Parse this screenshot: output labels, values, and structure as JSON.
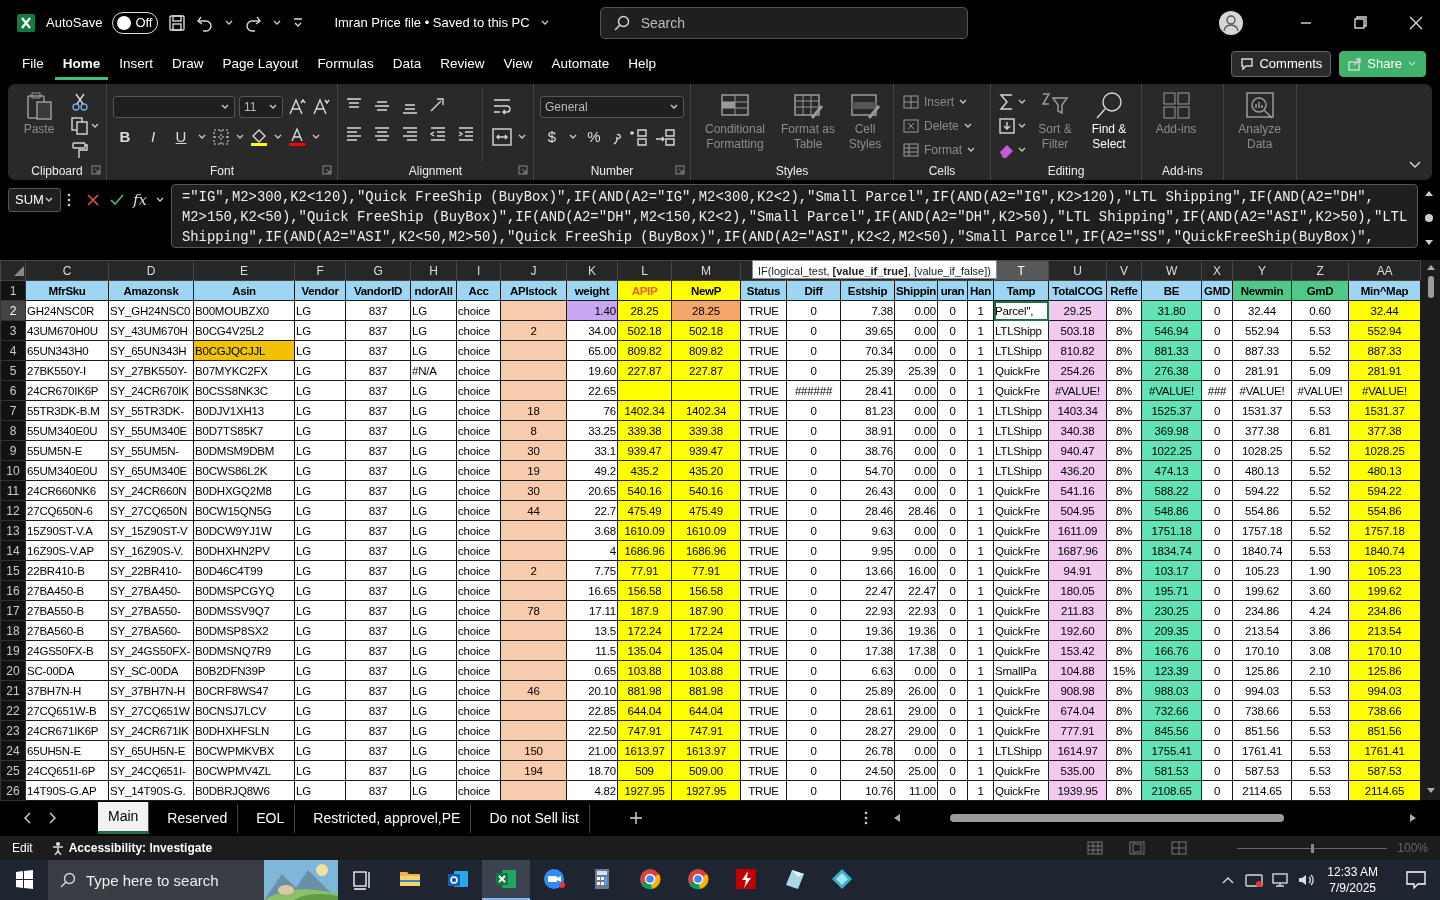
{
  "title_bar": {
    "autosave_label": "AutoSave",
    "autosave": {
      "on": false,
      "label": "Off"
    },
    "title": "Imran Price file • Saved to this PC",
    "search": {
      "placeholder": "Search"
    }
  },
  "menu": {
    "tabs": [
      {
        "label": "File",
        "selected": false
      },
      {
        "label": "Home",
        "selected": true
      },
      {
        "label": "Insert",
        "selected": false
      },
      {
        "label": "Draw",
        "selected": false
      },
      {
        "label": "Page Layout",
        "selected": false
      },
      {
        "label": "Formulas",
        "selected": false
      },
      {
        "label": "Data",
        "selected": false
      },
      {
        "label": "Review",
        "selected": false
      },
      {
        "label": "View",
        "selected": false
      },
      {
        "label": "Automate",
        "selected": false
      },
      {
        "label": "Help",
        "selected": false
      }
    ],
    "comments": "Comments",
    "share": "Share"
  },
  "ribbon": [
    {
      "kind": "clipboard",
      "label": "Clipboard",
      "items": [
        {
          "label": "Paste",
          "disabled": true
        }
      ]
    },
    {
      "kind": "font",
      "label": "Font",
      "font_size": "11",
      "buttons": [
        "B",
        "I",
        "U"
      ]
    },
    {
      "kind": "alignment",
      "label": "Alignment"
    },
    {
      "kind": "number",
      "label": "Number",
      "format": "General",
      "buttons": [
        "$",
        "%"
      ]
    },
    {
      "kind": "styles",
      "label": "Styles",
      "items": [
        {
          "label": "Conditional Formatting",
          "disabled": true
        },
        {
          "label": "Format as Table",
          "disabled": true
        },
        {
          "label": "Cell Styles",
          "disabled": true
        }
      ]
    },
    {
      "kind": "cells",
      "label": "Cells",
      "items": [
        {
          "label": "Insert",
          "disabled": true
        },
        {
          "label": "Delete",
          "disabled": true
        },
        {
          "label": "Format",
          "disabled": true
        }
      ]
    },
    {
      "kind": "editing",
      "label": "Editing",
      "items": [
        {
          "label": "Sort & Filter",
          "disabled": true
        },
        {
          "label": "Find & Select",
          "disabled": false
        }
      ]
    },
    {
      "kind": "addins",
      "label": "Add-ins",
      "items": [
        {
          "label": "Add-ins",
          "disabled": true
        }
      ]
    },
    {
      "kind": "analyze",
      "items": [
        {
          "label": "Analyze Data",
          "disabled": true
        }
      ]
    }
  ],
  "formula_bar": {
    "name_box": "SUM",
    "fx": "fx",
    "lines": [
      "=\"IG\",M2>300,K2<120),\"Quick FreeShip (BuyBox)\",IF(AND(A2=\"IG\",M2<300,K2<2),\"Small Parcel\",IF(AND(A2=\"IG\",K2>120),\"LTL Shipping\",IF(AND(A2=\"DH\",",
      "M2>150,K2<50),\"Quick FreeShip (BuyBox)\",IF(AND(A2=\"DH\",M2<150,K2<2),\"Small Parcel\",IF(AND(A2=\"DH\",K2>50),\"LTL Shipping\",IF(AND(A2=\"ASI\",K2>50),\"LTL",
      "Shipping\",IF(AND(A2=\"ASI\",K2<50,M2>50),\"Quick FreeShip (BuyBox)\",IF(AND(A2=\"ASI\",K2<2,M2<50),\"Small Parcel\",IF(A2=\"SS\",\"QuickFreeShip(BuyBox)\","
    ]
  },
  "tooltip": "IF(logical_test, **[value_if_true]**, [value_if_false])",
  "sheet": {
    "columns": [
      {
        "letter": "C",
        "selected": false
      },
      {
        "letter": "D",
        "selected": false
      },
      {
        "letter": "E",
        "selected": false
      },
      {
        "letter": "F",
        "selected": false
      },
      {
        "letter": "G",
        "selected": false
      },
      {
        "letter": "H",
        "selected": false
      },
      {
        "letter": "I",
        "selected": false
      },
      {
        "letter": "J",
        "color": "#f8cbad",
        "selected": false
      },
      {
        "letter": "K",
        "selected": false
      },
      {
        "letter": "L",
        "color": "#ffff00",
        "selected": false
      },
      {
        "letter": "M",
        "color": "#ffff00",
        "selected": false
      },
      {
        "selected": false
      },
      {
        "selected": false
      },
      {
        "selected": false
      },
      {
        "selected": false
      },
      {
        "selected": false
      },
      {
        "selected": false
      },
      {
        "letter": "T",
        "selected": true
      },
      {
        "letter": "U",
        "color": "#f2c9f0",
        "selected": false
      },
      {
        "letter": "V",
        "selected": false
      },
      {
        "letter": "W",
        "color": "#62e3b6",
        "selected": false
      },
      {
        "letter": "X",
        "selected": false
      },
      {
        "letter": "Y",
        "selected": false
      },
      {
        "letter": "Z",
        "selected": false
      },
      {
        "letter": "AA",
        "color": "#ffff00",
        "selected": false
      }
    ],
    "header": {
      "n": "1",
      "cells": [
        {
          "text": "MfrSku",
          "color": "#9dd5f2"
        },
        {
          "text": "Amazonsk",
          "color": "#9dd5f2"
        },
        {
          "text": "Asin",
          "color": "#9dd5f2"
        },
        {
          "text": "Vendor",
          "color": "#9dd5f2"
        },
        {
          "text": "VandorID",
          "color": "#9dd5f2"
        },
        {
          "text": "ndorAll",
          "color": "#9dd5f2"
        },
        {
          "text": "Acc",
          "color": "#9dd5f2"
        },
        {
          "text": "APIstock",
          "color": "#9dd5f2"
        },
        {
          "text": "weight",
          "color": "#9dd5f2"
        },
        {
          "text": "APIP",
          "color": "#ffff00",
          "kind": "alert"
        },
        {
          "text": "NewP",
          "color": "#ffff00"
        },
        {
          "text": "Status",
          "color": "#9dd5f2"
        },
        {
          "text": "Diff",
          "color": "#9dd5f2"
        },
        {
          "text": "Estship",
          "color": "#9dd5f2"
        },
        {
          "text": "Shippin",
          "color": "#9dd5f2"
        },
        {
          "text": "uran",
          "color": "#9dd5f2"
        },
        {
          "text": "Han",
          "color": "#9dd5f2"
        },
        {
          "text": "Tamp",
          "color": "#9dd5f2"
        },
        {
          "text": "TotalCOG",
          "color": "#9dd5f2"
        },
        {
          "text": "Reffe",
          "color": "#9dd5f2"
        },
        {
          "text": "BE",
          "color": "#9dd5f2"
        },
        {
          "text": "GMD",
          "color": "#9dd5f2"
        },
        {
          "text": "Newmin",
          "color": "#4fc98a"
        },
        {
          "text": "GmD",
          "color": "#4fc98a"
        },
        {
          "text": "Min^Map",
          "color": "#9dd5f2"
        }
      ]
    },
    "rows": [
      {
        "n": "2",
        "selected": true,
        "cells": [
          "GH24NSC0R",
          "SY_GH24NSC0",
          "B00MOUBZX0",
          "LG",
          "837",
          "LG",
          "choice",
          null,
          {
            "text": "1.40",
            "color": "#c9a6f2"
          },
          "28.25",
          {
            "text": "28.25",
            "color": "#f5a66c"
          },
          "TRUE",
          "0",
          "7.38",
          "0.00",
          "0",
          "1",
          {
            "text": "Parcel\",",
            "selected": true
          },
          "29.25",
          "8%",
          "31.80",
          "0",
          "32.44",
          "0.60",
          "32.44"
        ]
      },
      {
        "n": "3",
        "selected": false,
        "cells": [
          "43UM670H0U",
          "SY_43UM670H",
          "B0CG4V25L2",
          "LG",
          "837",
          "LG",
          "choice",
          "2",
          "34.00",
          "502.18",
          "502.18",
          "TRUE",
          "0",
          "39.65",
          "0.00",
          "0",
          "1",
          "LTLShipp",
          "503.18",
          "8%",
          "546.94",
          "0",
          "552.94",
          "5.53",
          "552.94"
        ]
      },
      {
        "n": "4",
        "selected": false,
        "cells": [
          "65UN343H0",
          "SY_65UN343H",
          {
            "text": "B0CGJQCJJL",
            "color": "#f2c200"
          },
          "LG",
          "837",
          "LG",
          "choice",
          null,
          "65.00",
          "809.82",
          "809.82",
          "TRUE",
          "0",
          "70.34",
          "0.00",
          "0",
          "1",
          "LTLShipp",
          "810.82",
          "8%",
          "881.33",
          "0",
          "887.33",
          "5.52",
          "887.33"
        ]
      },
      {
        "n": "5",
        "selected": false,
        "cells": [
          "27BK550Y-I",
          "SY_27BK550Y-",
          "B07MYKC2FX",
          "LG",
          "837",
          "#N/A",
          "choice",
          null,
          "19.60",
          "227.87",
          "227.87",
          "TRUE",
          "0",
          "25.39",
          "25.39",
          "0",
          "1",
          "QuickFre",
          "254.26",
          "8%",
          "276.38",
          "0",
          "281.91",
          "5.09",
          "281.91"
        ]
      },
      {
        "n": "6",
        "selected": false,
        "cells": [
          "24CR670IK6P",
          "SY_24CR670IK",
          "B0CSS8NK3C",
          "LG",
          "837",
          "LG",
          "choice",
          null,
          "22.65",
          null,
          null,
          "TRUE",
          "######",
          "28.41",
          "0.00",
          "0",
          "1",
          "QuickFre",
          "#VALUE!",
          "8%",
          "#VALUE!",
          "###",
          "#VALUE!",
          "#VALUE!",
          "#VALUE!"
        ]
      },
      {
        "n": "7",
        "selected": false,
        "cells": [
          "55TR3DK-B.M",
          "SY_55TR3DK-",
          "B0DJV1XH13",
          "LG",
          "837",
          "LG",
          "choice",
          "18",
          "76",
          "1402.34",
          "1402.34",
          "TRUE",
          "0",
          "81.23",
          "0.00",
          "0",
          "1",
          "LTLShipp",
          "1403.34",
          "8%",
          "1525.37",
          "0",
          "1531.37",
          "5.53",
          "1531.37"
        ]
      },
      {
        "n": "8",
        "selected": false,
        "cells": [
          "55UM340E0U",
          "SY_55UM340E",
          "B0D7TS85K7",
          "LG",
          "837",
          "LG",
          "choice",
          "8",
          "33.25",
          "339.38",
          "339.38",
          "TRUE",
          "0",
          "38.91",
          "0.00",
          "0",
          "1",
          "LTLShipp",
          "340.38",
          "8%",
          "369.98",
          "0",
          "377.38",
          "6.81",
          "377.38"
        ]
      },
      {
        "n": "9",
        "selected": false,
        "cells": [
          "55UM5N-E",
          "SY_55UM5N-",
          "B0DMSM9DBM",
          "LG",
          "837",
          "LG",
          "choice",
          "30",
          "33.1",
          "939.47",
          "939.47",
          "TRUE",
          "0",
          "38.76",
          "0.00",
          "0",
          "1",
          "LTLShipp",
          "940.47",
          "8%",
          "1022.25",
          "0",
          "1028.25",
          "5.52",
          "1028.25"
        ]
      },
      {
        "n": "10",
        "selected": false,
        "cells": [
          "65UM340E0U",
          "SY_65UM340E",
          "B0CWS86L2K",
          "LG",
          "837",
          "LG",
          "choice",
          "19",
          "49.2",
          "435.2",
          "435.20",
          "TRUE",
          "0",
          "54.70",
          "0.00",
          "0",
          "1",
          "LTLShipp",
          "436.20",
          "8%",
          "474.13",
          "0",
          "480.13",
          "5.52",
          "480.13"
        ]
      },
      {
        "n": "11",
        "selected": false,
        "cells": [
          "24CR660NK6",
          "SY_24CR660N",
          "B0DHXGQ2M8",
          "LG",
          "837",
          "LG",
          "choice",
          "30",
          "20.65",
          "540.16",
          "540.16",
          "TRUE",
          "0",
          "26.43",
          "0.00",
          "0",
          "1",
          "QuickFre",
          "541.16",
          "8%",
          "588.22",
          "0",
          "594.22",
          "5.52",
          "594.22"
        ]
      },
      {
        "n": "12",
        "selected": false,
        "cells": [
          "27CQ650N-6",
          "SY_27CQ650N",
          "B0CW15QN5G",
          "LG",
          "837",
          "LG",
          "choice",
          "44",
          "22.7",
          "475.49",
          "475.49",
          "TRUE",
          "0",
          "28.46",
          "28.46",
          "0",
          "1",
          "QuickFre",
          "504.95",
          "8%",
          "548.86",
          "0",
          "554.86",
          "5.52",
          "554.86"
        ]
      },
      {
        "n": "13",
        "selected": false,
        "cells": [
          "15Z90ST-V.A",
          "SY_15Z90ST-V",
          "B0DCW9YJ1W",
          "LG",
          "837",
          "LG",
          "choice",
          null,
          "3.68",
          "1610.09",
          "1610.09",
          "TRUE",
          "0",
          "9.63",
          "0.00",
          "0",
          "1",
          "QuickFre",
          "1611.09",
          "8%",
          "1751.18",
          "0",
          "1757.18",
          "5.52",
          "1757.18"
        ]
      },
      {
        "n": "14",
        "selected": false,
        "cells": [
          "16Z90S-V.AP",
          "SY_16Z90S-V.",
          "B0DHXHN2PV",
          "LG",
          "837",
          "LG",
          "choice",
          null,
          "4",
          "1686.96",
          "1686.96",
          "TRUE",
          "0",
          "9.95",
          "0.00",
          "0",
          "1",
          "QuickFre",
          "1687.96",
          "8%",
          "1834.74",
          "0",
          "1840.74",
          "5.53",
          "1840.74"
        ]
      },
      {
        "n": "15",
        "selected": false,
        "cells": [
          "22BR410-B",
          "SY_22BR410-",
          "B0D46C4T99",
          "LG",
          "837",
          "LG",
          "choice",
          "2",
          "7.75",
          "77.91",
          "77.91",
          "TRUE",
          "0",
          "13.66",
          "16.00",
          "0",
          "1",
          "QuickFre",
          "94.91",
          "8%",
          "103.17",
          "0",
          "105.23",
          "1.90",
          "105.23"
        ]
      },
      {
        "n": "16",
        "selected": false,
        "cells": [
          "27BA450-B",
          "SY_27BA450-",
          "B0DMSPCGYQ",
          "LG",
          "837",
          "LG",
          "choice",
          null,
          "16.65",
          "156.58",
          "156.58",
          "TRUE",
          "0",
          "22.47",
          "22.47",
          "0",
          "1",
          "QuickFre",
          "180.05",
          "8%",
          "195.71",
          "0",
          "199.62",
          "3.60",
          "199.62"
        ]
      },
      {
        "n": "17",
        "selected": false,
        "cells": [
          "27BA550-B",
          "SY_27BA550-",
          "B0DMSSV9Q7",
          "LG",
          "837",
          "LG",
          "choice",
          "78",
          "17.11",
          "187.9",
          "187.90",
          "TRUE",
          "0",
          "22.93",
          "22.93",
          "0",
          "1",
          "QuickFre",
          "211.83",
          "8%",
          "230.25",
          "0",
          "234.86",
          "4.24",
          "234.86"
        ]
      },
      {
        "n": "18",
        "selected": false,
        "cells": [
          "27BA560-B",
          "SY_27BA560-",
          "B0DMSP8SX2",
          "LG",
          "837",
          "LG",
          "choice",
          null,
          "13.5",
          "172.24",
          "172.24",
          "TRUE",
          "0",
          "19.36",
          "19.36",
          "0",
          "1",
          "QuickFre",
          "192.60",
          "8%",
          "209.35",
          "0",
          "213.54",
          "3.86",
          "213.54"
        ]
      },
      {
        "n": "19",
        "selected": false,
        "cells": [
          "24GS50FX-B",
          "SY_24GS50FX-",
          "B0DMSNQ7R9",
          "LG",
          "837",
          "LG",
          "choice",
          null,
          "11.5",
          "135.04",
          "135.04",
          "TRUE",
          "0",
          "17.38",
          "17.38",
          "0",
          "1",
          "QuickFre",
          "153.42",
          "8%",
          "166.76",
          "0",
          "170.10",
          "3.08",
          "170.10"
        ]
      },
      {
        "n": "20",
        "selected": false,
        "cells": [
          "SC-00DA",
          "SY_SC-00DA",
          "B0B2DFN39P",
          "LG",
          "837",
          "LG",
          "choice",
          null,
          "0.65",
          "103.88",
          "103.88",
          "TRUE",
          "0",
          "6.63",
          "0.00",
          "0",
          "1",
          "SmallPa",
          "104.88",
          "15%",
          "123.39",
          "0",
          "125.86",
          "2.10",
          "125.86"
        ]
      },
      {
        "n": "21",
        "selected": false,
        "cells": [
          "37BH7N-H",
          "SY_37BH7N-H",
          "B0CRF8WS47",
          "LG",
          "837",
          "LG",
          "choice",
          "46",
          "20.10",
          "881.98",
          "881.98",
          "TRUE",
          "0",
          "25.89",
          "26.00",
          "0",
          "1",
          "QuickFre",
          "908.98",
          "8%",
          "988.03",
          "0",
          "994.03",
          "5.53",
          "994.03"
        ]
      },
      {
        "n": "22",
        "selected": false,
        "cells": [
          "27CQ651W-B",
          "SY_27CQ651W",
          "B0CNSJ7LCV",
          "LG",
          "837",
          "LG",
          "choice",
          null,
          "22.85",
          "644.04",
          "644.04",
          "TRUE",
          "0",
          "28.61",
          "29.00",
          "0",
          "1",
          "QuickFre",
          "674.04",
          "8%",
          "732.66",
          "0",
          "738.66",
          "5.53",
          "738.66"
        ]
      },
      {
        "n": "23",
        "selected": false,
        "cells": [
          "24CR671IK6P",
          "SY_24CR671IK",
          "B0DHXHFSLN",
          "LG",
          "837",
          "LG",
          "choice",
          null,
          "22.50",
          "747.91",
          "747.91",
          "TRUE",
          "0",
          "28.27",
          "29.00",
          "0",
          "1",
          "QuickFre",
          "777.91",
          "8%",
          "845.56",
          "0",
          "851.56",
          "5.53",
          "851.56"
        ]
      },
      {
        "n": "24",
        "selected": false,
        "cells": [
          "65UH5N-E",
          "SY_65UH5N-E",
          "B0CWPMKVBX",
          "LG",
          "837",
          "LG",
          "choice",
          "150",
          "21.00",
          "1613.97",
          "1613.97",
          "TRUE",
          "0",
          "26.78",
          "0.00",
          "0",
          "1",
          "LTLShipp",
          "1614.97",
          "8%",
          "1755.41",
          "0",
          "1761.41",
          "5.53",
          "1761.41"
        ]
      },
      {
        "n": "25",
        "selected": false,
        "cells": [
          "24CQ651I-6P",
          "SY_24CQ651I-",
          "B0CWPMV4ZL",
          "LG",
          "837",
          "LG",
          "choice",
          "194",
          "18.70",
          "509",
          "509.00",
          "TRUE",
          "0",
          "24.50",
          "25.00",
          "0",
          "1",
          "QuickFre",
          "535.00",
          "8%",
          "581.53",
          "0",
          "587.53",
          "5.53",
          "587.53"
        ]
      },
      {
        "n": "26",
        "selected": false,
        "cells": [
          "14T90S-G.AP",
          "SY_14T90S-G.",
          "B0DBRJQ8W6",
          "LG",
          "837",
          "LG",
          "choice",
          null,
          "4.82",
          "1927.95",
          "1927.95",
          "TRUE",
          "0",
          "10.76",
          "11.00",
          "0",
          "1",
          "QuickFre",
          "1939.95",
          "8%",
          "2108.65",
          "0",
          "2114.65",
          "5.53",
          "2114.65"
        ]
      }
    ]
  },
  "sheet_tabs": [
    {
      "label": "Main",
      "selected": true
    },
    {
      "label": "Reserved",
      "selected": false
    },
    {
      "label": "EOL",
      "selected": false
    },
    {
      "label": "Restricted, approvel,PE",
      "selected": false
    },
    {
      "label": "Do not Sell list",
      "selected": false
    }
  ],
  "status_bar": {
    "mode": "Edit",
    "accessibility": "Accessibility: Investigate",
    "zoom_slider": {
      "level": 0.5
    },
    "zoom": "100%"
  },
  "taskbar": {
    "search_placeholder": "Type here to search",
    "apps": [
      {
        "kind": "folder",
        "selected": false
      },
      {
        "kind": "mail",
        "selected": false
      },
      {
        "kind": "sheet",
        "selected": true
      },
      {
        "kind": "meeting",
        "selected": false
      },
      {
        "kind": "calculator",
        "selected": false
      },
      {
        "kind": "browser",
        "selected": false
      },
      {
        "kind": "browser",
        "selected": false
      },
      {
        "kind": "ftp",
        "selected": false
      },
      {
        "kind": "glass",
        "selected": false
      },
      {
        "kind": "diamond",
        "selected": false
      }
    ],
    "time": "12:33 AM",
    "date": "7/9/2025"
  }
}
